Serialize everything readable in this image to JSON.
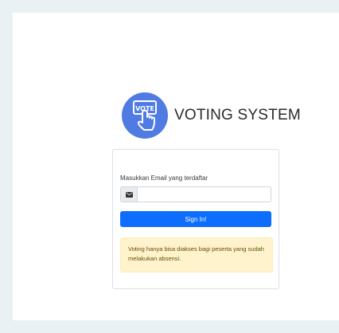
{
  "brand": {
    "logo_text": "VOTE",
    "title": "VOTING SYSTEM"
  },
  "login": {
    "email_label": "Masukkan Email yang terdaftar",
    "email_value": "",
    "email_icon": "envelope-icon",
    "submit_label": "Sign In!"
  },
  "notice": {
    "text": "Voting hanya bisa diakses bagi peserta yang sudah melakukan absensi."
  },
  "colors": {
    "background": "#e9f1f5",
    "logo": "#4f7be3",
    "primary": "#0d6efd",
    "alert_bg": "#fff3cd"
  }
}
